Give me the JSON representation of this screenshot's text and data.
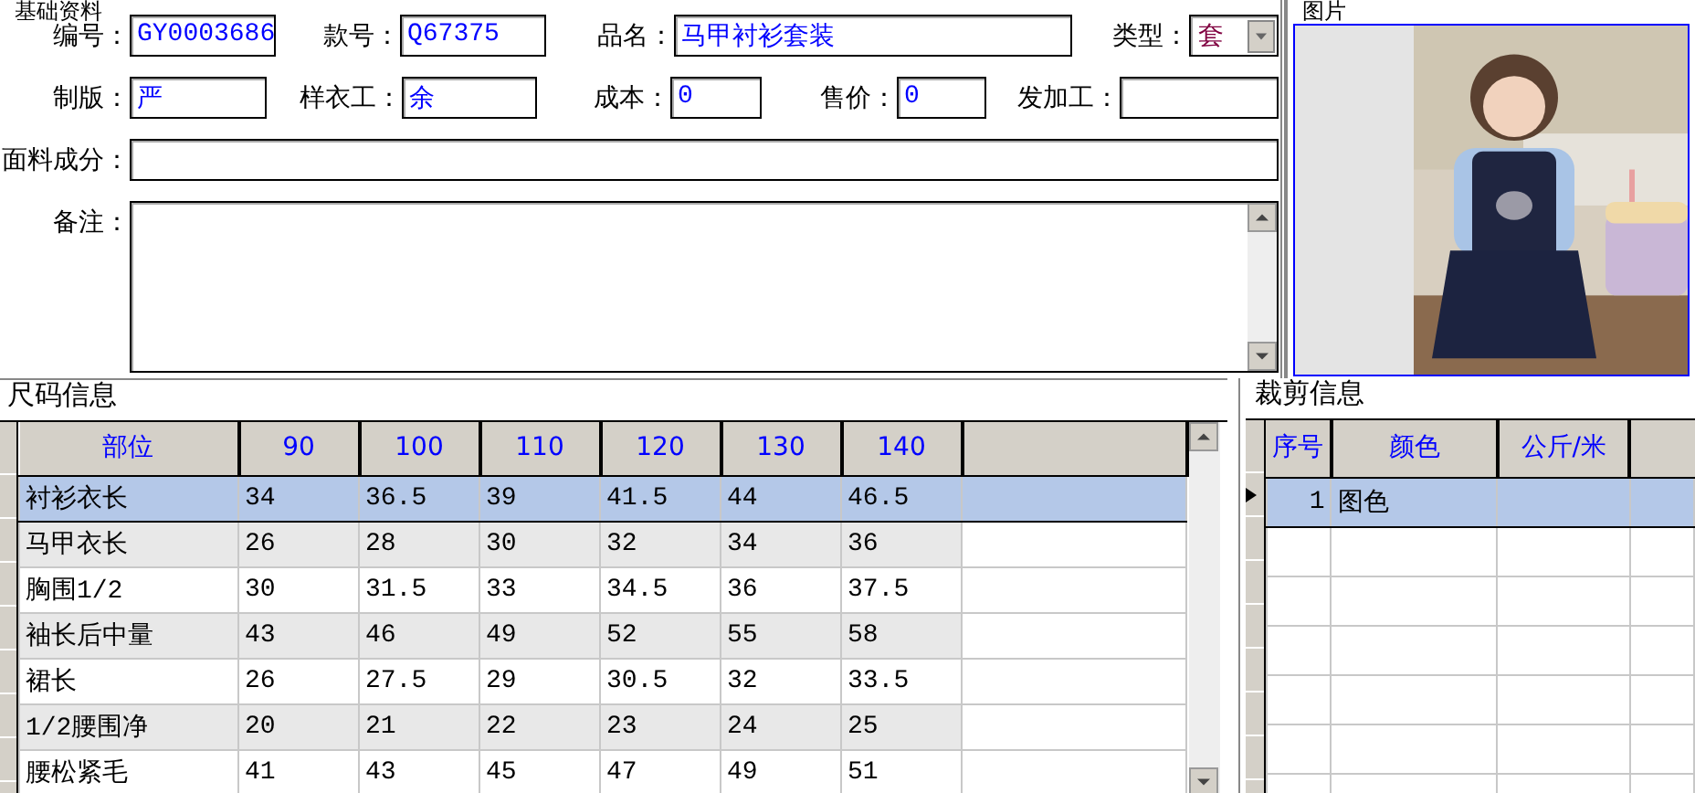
{
  "basic_info": {
    "title": "基础资料",
    "field_rows": [
      {
        "fields": [
          {
            "label": "编号：",
            "value": "GY0003686",
            "kind": "text"
          },
          {
            "label": "款号：",
            "value": "Q67375",
            "kind": "text"
          },
          {
            "label": "品名：",
            "value": "马甲衬衫套装",
            "kind": "text"
          },
          {
            "label": "类型：",
            "value": "套",
            "kind": "select"
          }
        ]
      },
      {
        "fields": [
          {
            "label": "制版：",
            "value": "严",
            "kind": "text"
          },
          {
            "label": "样衣工：",
            "value": "余",
            "kind": "text"
          },
          {
            "label": "成本：",
            "value": "0",
            "kind": "text"
          },
          {
            "label": "售价：",
            "value": "0",
            "kind": "text"
          },
          {
            "label": "发加工：",
            "kind": "text"
          }
        ]
      },
      {
        "fields": [
          {
            "label": "面料成分：",
            "kind": "text"
          }
        ]
      },
      {
        "fields": [
          {
            "label": "备注：",
            "kind": "textarea"
          }
        ]
      }
    ]
  },
  "picture_panel": {
    "title": "图片",
    "kind": "picture"
  },
  "size_info": {
    "title": "尺码信息",
    "columns": [
      "部位",
      "90",
      "100",
      "110",
      "120",
      "130",
      "140"
    ],
    "rows": [
      {
        "cells": [
          "衬衫衣长",
          "34",
          "36.5",
          "39",
          "41.5",
          "44",
          "46.5"
        ],
        "selected": true
      },
      {
        "cells": [
          "马甲衣长",
          "26",
          "28",
          "30",
          "32",
          "34",
          "36"
        ],
        "selected": false
      },
      {
        "cells": [
          "胸围1/2",
          "30",
          "31.5",
          "33",
          "34.5",
          "36",
          "37.5"
        ],
        "selected": false
      },
      {
        "cells": [
          "袖长后中量",
          "43",
          "46",
          "49",
          "52",
          "55",
          "58"
        ],
        "selected": false
      },
      {
        "cells": [
          "裙长",
          "26",
          "27.5",
          "29",
          "30.5",
          "32",
          "33.5"
        ],
        "selected": false
      },
      {
        "cells": [
          "1/2腰围净",
          "20",
          "21",
          "22",
          "23",
          "24",
          "25"
        ],
        "selected": false
      },
      {
        "cells": [
          "腰松紧毛",
          "41",
          "43",
          "45",
          "47",
          "49",
          "51"
        ],
        "selected": false
      }
    ]
  },
  "cut_info": {
    "title": "裁剪信息",
    "columns": [
      "序号",
      "颜色",
      "公斤/米"
    ],
    "rows": [
      {
        "cells": [
          "1",
          "图色",
          ""
        ],
        "selected": true
      }
    ]
  }
}
